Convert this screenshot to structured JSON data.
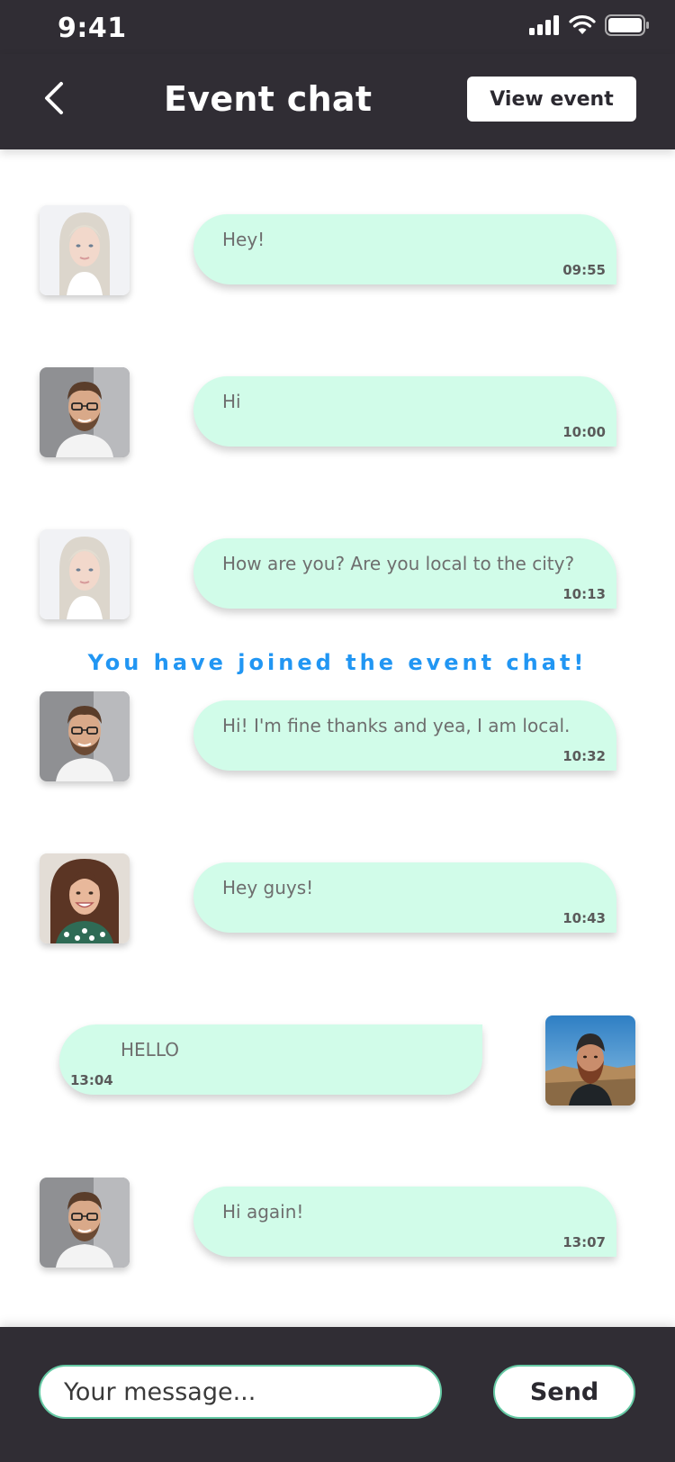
{
  "status_bar": {
    "time": "9:41",
    "icons": [
      "signal-icon",
      "wifi-icon",
      "battery-icon"
    ]
  },
  "header": {
    "back_icon": "chevron-left-icon",
    "title": "Event chat",
    "view_event_label": "View event"
  },
  "messages": [
    {
      "text": "Hey!",
      "time": "09:55",
      "avatar": "avatar-blonde-woman"
    },
    {
      "text": "Hi",
      "time": "10:00",
      "avatar": "avatar-man-glasses"
    },
    {
      "text": "How are you? Are you local to the city?",
      "time": "10:13",
      "avatar": "avatar-blonde-woman"
    },
    {
      "text": "Hi! I'm fine thanks and yea, I am local.",
      "time": "10:32",
      "avatar": "avatar-man-glasses"
    },
    {
      "text": "Hey guys!",
      "time": "10:43",
      "avatar": "avatar-curly-woman"
    },
    {
      "text": "HELLO",
      "time": "13:04",
      "avatar": "avatar-bearded-man",
      "own": true
    },
    {
      "text": "Hi again!",
      "time": "13:07",
      "avatar": "avatar-man-glasses"
    }
  ],
  "system_notice": "You have joined the event chat!",
  "composer": {
    "placeholder": "Your message...",
    "send_label": "Send"
  },
  "colors": {
    "bar_background": "#302d34",
    "bubble": "#d1fce9",
    "notice": "#2196f3",
    "accent_border": "#65c9a4"
  }
}
